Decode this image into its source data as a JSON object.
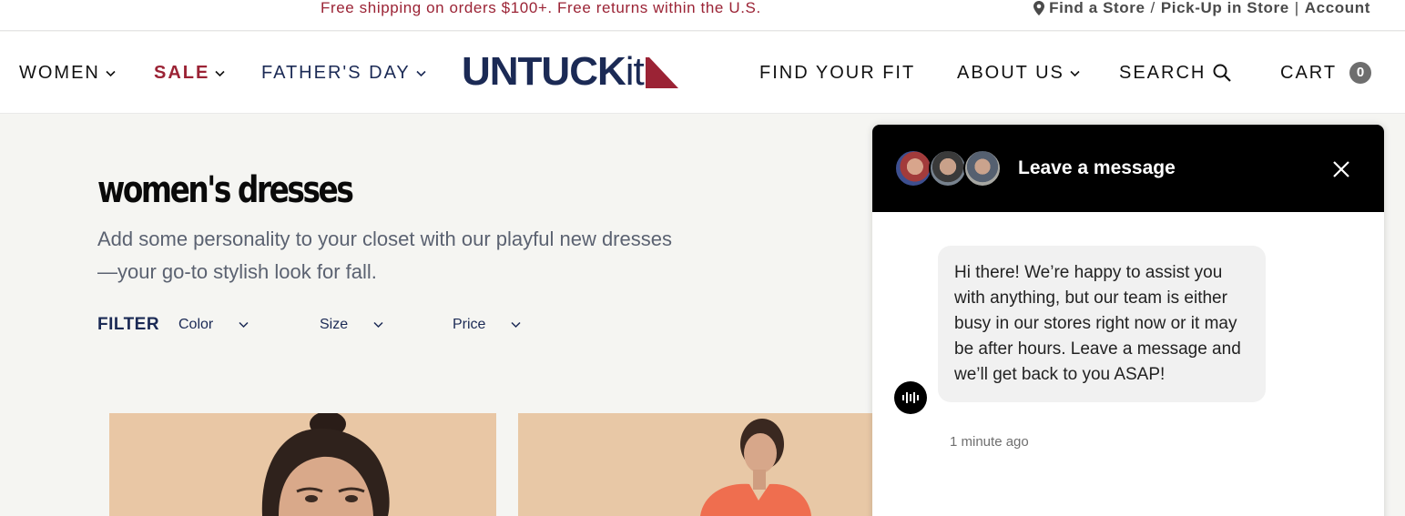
{
  "topbar": {
    "promo": "Free shipping on orders $100+. Free returns within the U.S.",
    "find_store": "Find a Store",
    "separator": "/",
    "pickup": "Pick-Up in Store",
    "divider": "|",
    "account": "Account"
  },
  "nav": {
    "women": "WOMEN",
    "sale": "SALE",
    "fathers_day": "FATHER'S DAY",
    "logo": "UNTUCK",
    "logo_it": "it",
    "find_fit": "FIND YOUR FIT",
    "about": "ABOUT US",
    "search": "SEARCH",
    "cart": "CART",
    "cart_count": "0"
  },
  "page": {
    "title": "women's dresses",
    "description": "Add some personality to your closet with our playful new dresses—your go-to stylish look for fall."
  },
  "filters": {
    "label": "FILTER",
    "color": "Color",
    "size": "Size",
    "price": "Price"
  },
  "chat": {
    "title": "Leave a message",
    "message": "Hi there! We’re happy to assist you with anything, but our team is either busy in our stores right now or it may be after hours. Leave a message and we’ll get back to you ASAP!",
    "timestamp": "1 minute ago"
  },
  "colors": {
    "brand_navy": "#1b2a55",
    "sale_red": "#9b2335",
    "chat_header": "#000000"
  },
  "icons": [
    "map-pin-icon",
    "chevron-down-icon",
    "search-icon",
    "cart-badge",
    "close-icon",
    "audio-wave-icon"
  ]
}
